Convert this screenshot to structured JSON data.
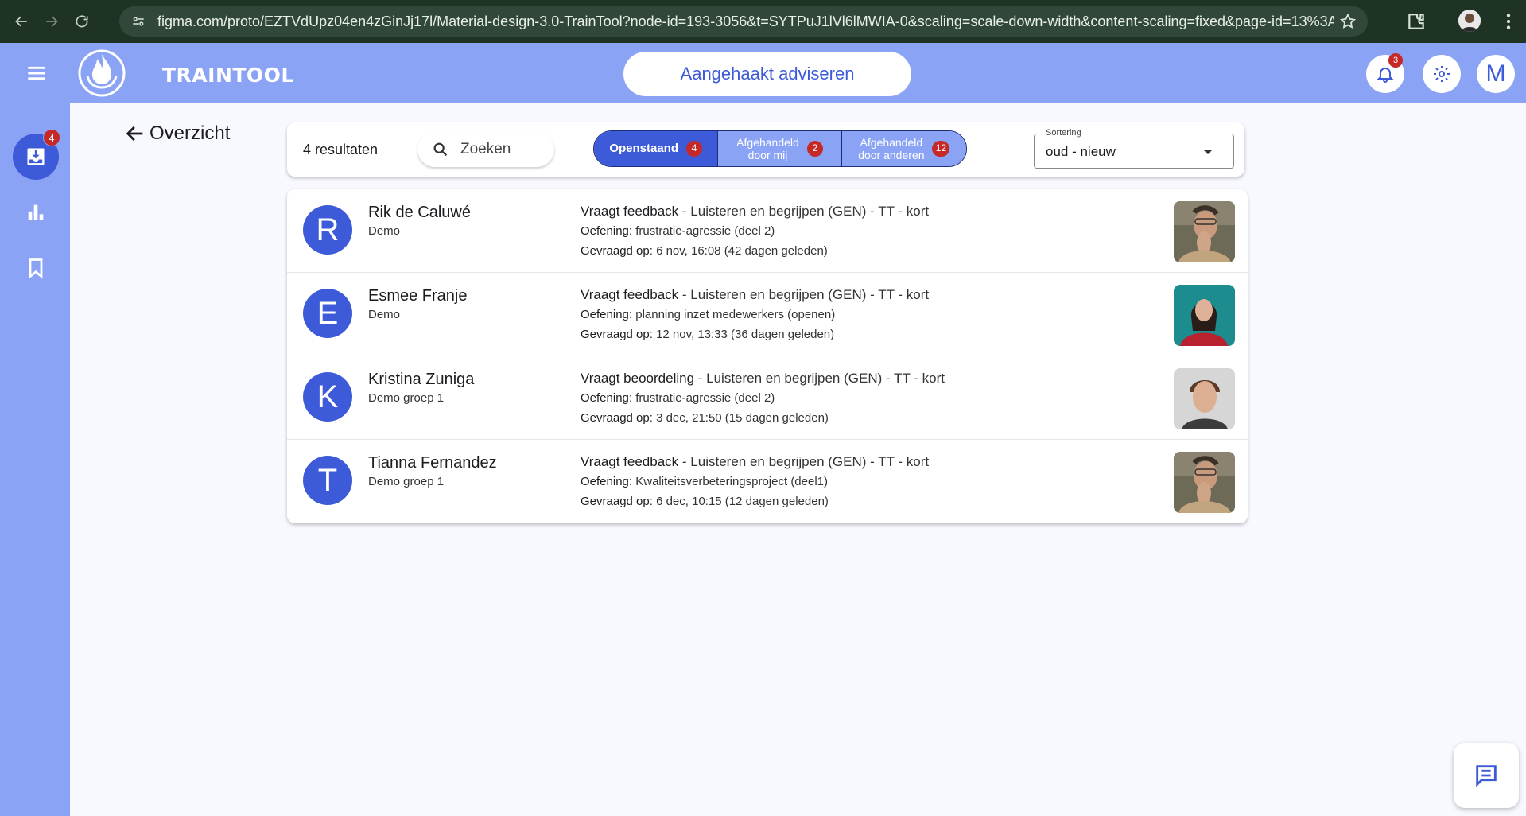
{
  "browser": {
    "url": "figma.com/proto/EZTVdUpz04en4zGinJj17l/Material-design-3.0-TrainTool?node-id=193-3056&t=SYTPuJ1lVl6lMWIA-0&scaling=scale-down-width&content-scaling=fixed&page-id=13%3A129..."
  },
  "header": {
    "brand": "TRAINTOOL",
    "center_label": "Aangehaakt adviseren",
    "notification_count": "3",
    "user_initial": "M"
  },
  "sidebar": {
    "inbox_badge": "4"
  },
  "back_label": "Overzicht",
  "filter": {
    "results": "4 resultaten",
    "search_placeholder": "Zoeken",
    "tabs": [
      {
        "label": "Openstaand",
        "count": "4"
      },
      {
        "label_line1": "Afgehandeld",
        "label_line2": "door mij",
        "count": "2"
      },
      {
        "label_line1": "Afgehandeld",
        "label_line2": "door anderen",
        "count": "12"
      }
    ],
    "sort_label": "Sortering",
    "sort_value": "oud - nieuw"
  },
  "rows": [
    {
      "initial": "R",
      "name": "Rik de Caluwé",
      "group": "Demo",
      "request_type": "Vraagt feedback",
      "request_rest": " - Luisteren en begrijpen (GEN) - TT - kort",
      "exercise_label": "Oefening",
      "exercise": ": frustratie-agressie (deel 2)",
      "date_label": "Gevraagd op",
      "date": ": 6 nov, 16:08 (42 dagen geleden)",
      "thumb": "man-hand-face"
    },
    {
      "initial": "E",
      "name": "Esmee Franje",
      "group": "Demo",
      "request_type": "Vraagt feedback",
      "request_rest": " - Luisteren en begrijpen (GEN) - TT - kort",
      "exercise_label": "Oefening",
      "exercise": ": planning inzet medewerkers (openen)",
      "date_label": "Gevraagd op",
      "date": ": 12 nov, 13:33 (36 dagen geleden)",
      "thumb": "woman-red-teal"
    },
    {
      "initial": "K",
      "name": "Kristina Zuniga",
      "group": "Demo groep 1",
      "request_type": "Vraagt beoordeling",
      "request_rest": " - Luisteren en begrijpen (GEN) - TT - kort",
      "exercise_label": "Oefening",
      "exercise": ": frustratie-agressie (deel 2)",
      "date_label": "Gevraagd op",
      "date": ": 3 dec, 21:50 (15 dagen geleden)",
      "thumb": "man-portrait"
    },
    {
      "initial": "T",
      "name": "Tianna Fernandez",
      "group": "Demo groep 1",
      "request_type": "Vraagt feedback",
      "request_rest": " - Luisteren en begrijpen (GEN) - TT - kort",
      "exercise_label": "Oefening",
      "exercise": ": Kwaliteitsverbeteringsproject (deel1)",
      "date_label": "Gevraagd op",
      "date": ": 6 dec, 10:15 (12 dagen geleden)",
      "thumb": "man-hand-face"
    }
  ],
  "colors": {
    "primary": "#3d5bd8",
    "appbar": "#8ba3f4",
    "badge": "#c62828",
    "chrome": "#1e3323"
  }
}
